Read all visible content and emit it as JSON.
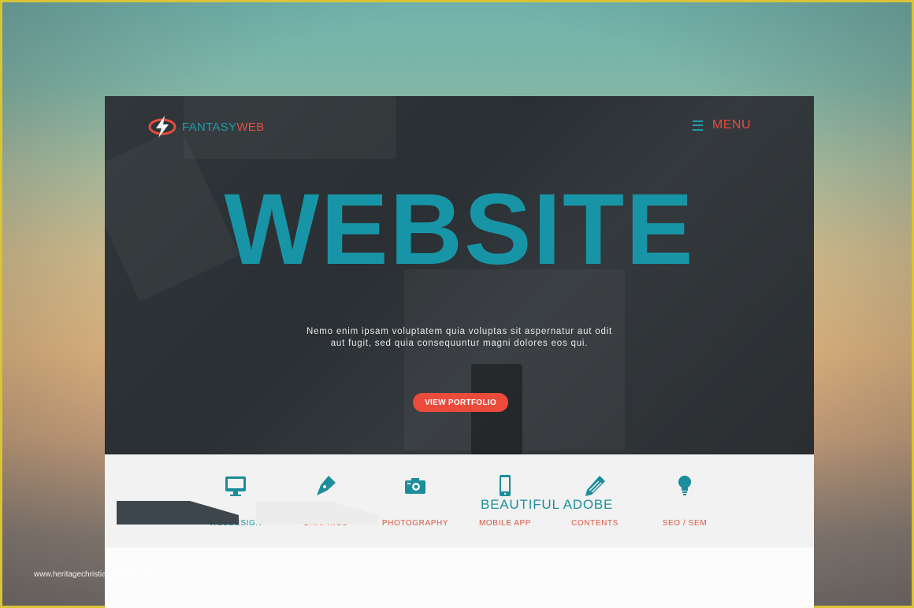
{
  "header": {
    "logo_part1": "FANTASY",
    "logo_part2": "WEB",
    "menu_label": "MENU"
  },
  "hero": {
    "title": "WEBSITE",
    "subtitle_line1": "Nemo enim ipsam voluptatem quia voluptas sit aspernatur aut odit",
    "subtitle_line2": "aut fugit, sed quia consequuntur magni dolores eos qui.",
    "button": "VIEW PORTFOLIO"
  },
  "services": [
    {
      "label": "WEBDESIGN",
      "icon": "monitor-icon"
    },
    {
      "label": "GRAPHICS",
      "icon": "pen-nib-icon"
    },
    {
      "label": "PHOTOGRAPHY",
      "icon": "camera-icon"
    },
    {
      "label": "MOBILE APP",
      "icon": "mobile-icon"
    },
    {
      "label": "CONTENTS",
      "icon": "pencil-icon"
    },
    {
      "label": "SEO / SEM",
      "icon": "lightbulb-icon"
    }
  ],
  "section": {
    "title": "BEAUTIFUL ADOBE"
  },
  "watermark": "www.heritagechristiancollege.com",
  "colors": {
    "accent": "#1795a6",
    "brand_red": "#e84c3d",
    "hero_bg": "#2d3236"
  }
}
